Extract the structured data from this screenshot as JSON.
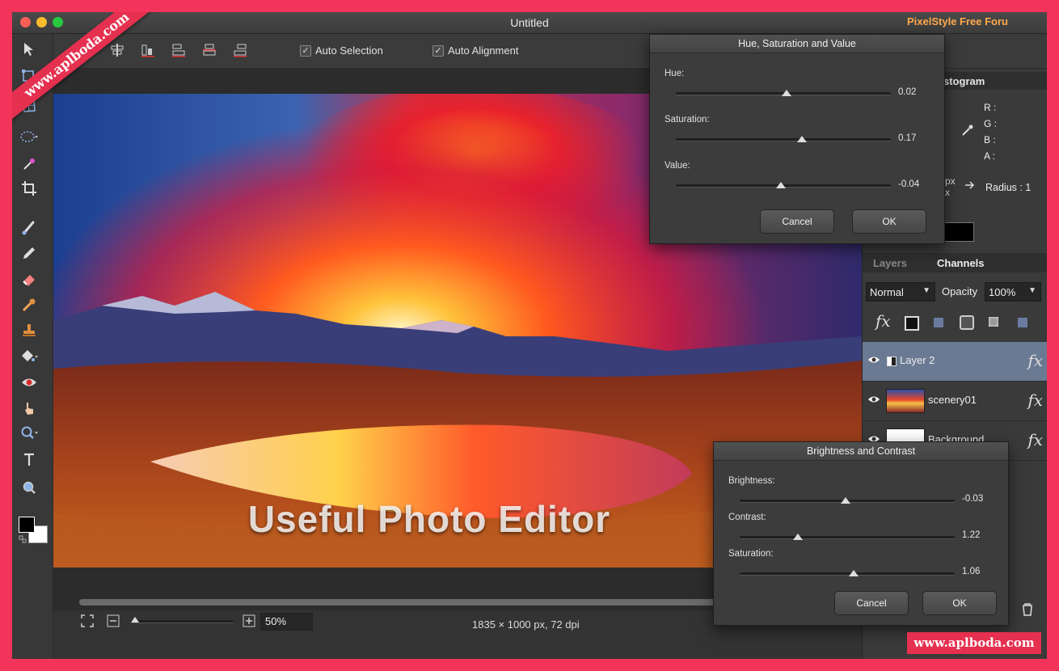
{
  "window": {
    "title": "Untitled",
    "brand": "PixelStyle Free Foru"
  },
  "toolbar": {
    "auto_selection": "Auto Selection",
    "auto_alignment": "Auto Alignment"
  },
  "canvas": {
    "overlay_text": "Useful Photo Editor"
  },
  "status": {
    "zoom": "50%",
    "dimensions": "1835 × 1000 px, 72 dpi"
  },
  "histogram": {
    "title": "stogram",
    "r": "R :",
    "g": "G :",
    "b": "B :",
    "a": "A :",
    "px1": "px",
    "px2": "x",
    "radius": "Radius :  1"
  },
  "layers_panel": {
    "tab_layers": "Layers",
    "tab_channels": "Channels",
    "blend_mode": "Normal",
    "opacity_label": "Opacity",
    "opacity_value": "100%",
    "fx": "fx",
    "layers": [
      {
        "name": "Layer 2",
        "fx": "fx"
      },
      {
        "name": "scenery01",
        "fx": "fx"
      },
      {
        "name": "Background",
        "fx": "fx"
      }
    ]
  },
  "hsv_dialog": {
    "title": "Hue, Saturation and Value",
    "hue_label": "Hue:",
    "hue_value": "0.02",
    "sat_label": "Saturation:",
    "sat_value": "0.17",
    "val_label": "Value:",
    "val_value": "-0.04",
    "cancel": "Cancel",
    "ok": "OK"
  },
  "bc_dialog": {
    "title": "Brightness and Contrast",
    "brightness_label": "Brightness:",
    "brightness_value": "-0.03",
    "contrast_label": "Contrast:",
    "contrast_value": "1.22",
    "saturation_label": "Saturation:",
    "saturation_value": "1.06",
    "cancel": "Cancel",
    "ok": "OK"
  },
  "watermark": {
    "ribbon": "www.aplboda.com",
    "corner": "www.aplboda.com"
  },
  "colors": {
    "accent": "#f2345b",
    "panel": "#3a3a3a",
    "selected_layer": "#6b7a93"
  }
}
